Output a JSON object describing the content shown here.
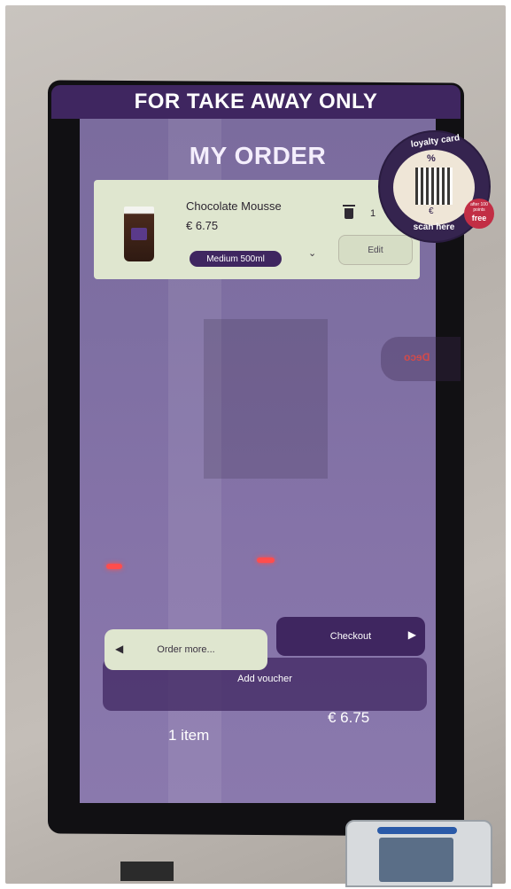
{
  "banner": {
    "text": "FOR TAKE AWAY ONLY"
  },
  "screen": {
    "title": "MY ORDER"
  },
  "order_item": {
    "name": "Chocolate Mousse",
    "price": "€ 6.75",
    "size": "Medium 500ml",
    "quantity": "1",
    "edit_label": "Edit"
  },
  "loyalty_sticker": {
    "top_text": "loyalty card",
    "bottom_text": "scan here",
    "symbol_top": "%",
    "symbol_bottom": "€",
    "promo_small": "after 100 points",
    "promo_big": "free"
  },
  "background_sign": {
    "text": "Deco"
  },
  "actions": {
    "order_more_label": "Order more...",
    "checkout_label": "Checkout",
    "voucher_label": "Add voucher"
  },
  "summary": {
    "items": "1 item",
    "total": "€ 6.75"
  },
  "colors": {
    "primary": "#3f2660",
    "card_bg": "#dfe6cf",
    "screen_bg": "#7e6fa2",
    "accent_red": "#c22e45"
  }
}
